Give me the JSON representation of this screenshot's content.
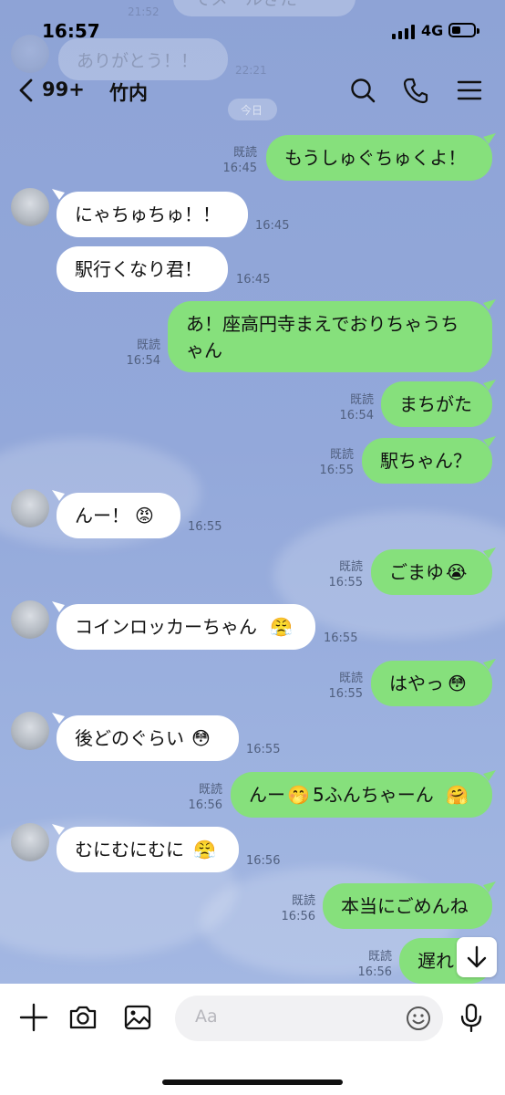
{
  "status": {
    "time": "16:57",
    "network": "4G"
  },
  "background_ghosts": {
    "top_text": "でメールきた",
    "top_time": "21:52",
    "thanks_text": "ありがとう！！",
    "thanks_time": "22:21",
    "date_chip": "今日"
  },
  "header": {
    "unread_count": "99+",
    "title": "竹内"
  },
  "messages": [
    {
      "side": "me",
      "text": "もうしゅぐちゅくよ！",
      "read": "既読",
      "time": "16:45"
    },
    {
      "side": "other",
      "text": "にゃちゅちゅ！！",
      "time": "16:45"
    },
    {
      "side": "other",
      "text": "駅行くなり君！",
      "time": "16:45"
    },
    {
      "side": "me",
      "text_line1": "あ！座高円寺まえでおりちゃうち",
      "text_line2": "ゃん",
      "read": "既読",
      "time": "16:54"
    },
    {
      "side": "me",
      "text": "まちがた",
      "read": "既読",
      "time": "16:54"
    },
    {
      "side": "me",
      "text": "駅ちゃん？",
      "read": "既読",
      "time": "16:55"
    },
    {
      "side": "other",
      "text": "んー！",
      "emoji": "😡",
      "time": "16:55"
    },
    {
      "side": "me",
      "text": "ごまゆ",
      "emoji": "😭",
      "read": "既読",
      "time": "16:55"
    },
    {
      "side": "other",
      "text": "コインロッカーちゃん",
      "emoji": "😤",
      "time": "16:55"
    },
    {
      "side": "me",
      "text": "はやっ",
      "emoji": "😳",
      "read": "既読",
      "time": "16:55"
    },
    {
      "side": "other",
      "text": "後どのぐらい",
      "emoji": "😳",
      "time": "16:55"
    },
    {
      "side": "me",
      "text_a": "んー",
      "emoji_a": "🤭",
      "text_b": "5ふんちゃーん",
      "emoji_b": "🤗",
      "read": "既読",
      "time": "16:56"
    },
    {
      "side": "other",
      "text": "むにむにむに",
      "emoji": "😤",
      "time": "16:56"
    },
    {
      "side": "me",
      "text": "本当にごめんね",
      "read": "既読",
      "time": "16:56"
    },
    {
      "side": "me",
      "text": "遅れ",
      "read": "既読",
      "time": "16:56"
    }
  ],
  "input": {
    "placeholder": "Aa"
  },
  "colors": {
    "bubble_me": "#86e07c",
    "bubble_other": "#ffffff",
    "background": "#8fa5d8"
  },
  "icons": [
    "back-chevron-icon",
    "search-icon",
    "phone-icon",
    "menu-icon",
    "plus-icon",
    "camera-icon",
    "image-icon",
    "emoji-icon",
    "microphone-icon",
    "scroll-down-arrow-icon"
  ]
}
